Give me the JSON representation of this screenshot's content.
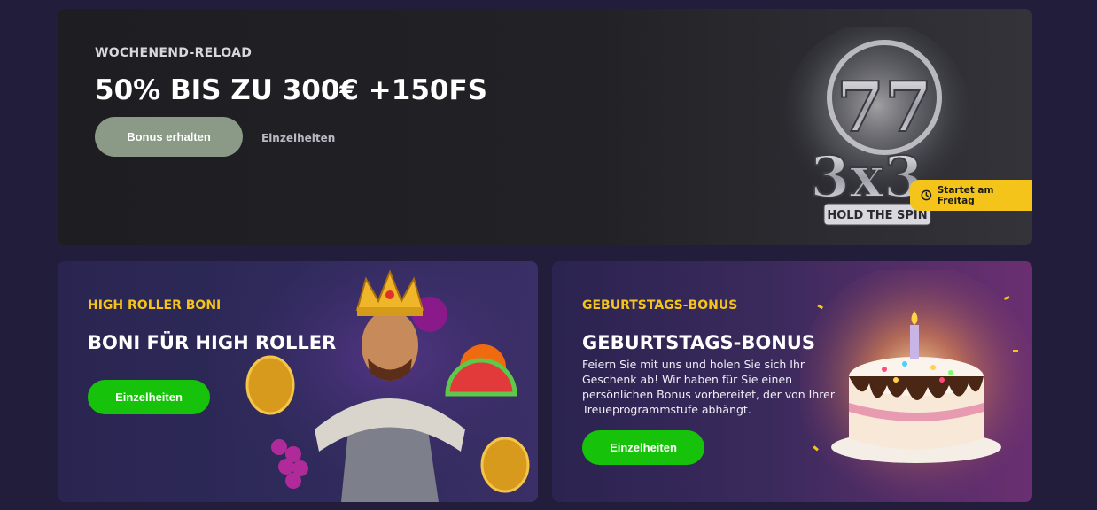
{
  "weekend_reload": {
    "eyebrow": "WOCHENEND-RELOAD",
    "headline": "50% BIS ZU 300€ +150FS",
    "cta_label": "Bonus erhalten",
    "details_label": "Einzelheiten",
    "game_logo": {
      "line1": "77",
      "line2": "3x3",
      "line3": "HOLD THE SPIN"
    },
    "badge": {
      "icon": "clock-icon",
      "label": "Startet am Freitag"
    }
  },
  "high_roller": {
    "eyebrow": "HIGH ROLLER BONI",
    "title": "BONI FÜR HIGH ROLLER",
    "cta_label": "Einzelheiten"
  },
  "birthday": {
    "eyebrow": "GEBURTSTAGS-BONUS",
    "title": "GEBURTSTAGS-BONUS",
    "description": "Feiern Sie mit uns und holen Sie sich Ihr Geschenk ab! Wir haben für Sie einen persönlichen Bonus vorbereitet, der von Ihrer Treueprogrammstufe abhängt.",
    "cta_label": "Einzelheiten"
  },
  "colors": {
    "page_bg": "#221d3a",
    "accent_yellow": "#f5c41a",
    "cta_green": "#17c20a",
    "cta_grey": "#8a9a86"
  }
}
